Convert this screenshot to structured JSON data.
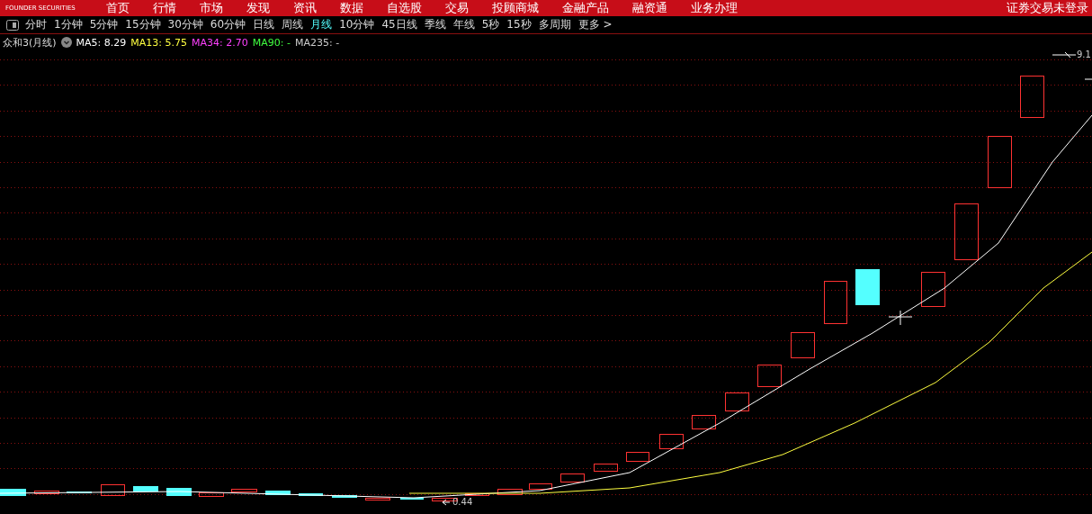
{
  "header": {
    "logo": "FOUNDER SECURITIES",
    "nav": [
      "首页",
      "行情",
      "市场",
      "发现",
      "资讯",
      "数据",
      "自选股",
      "交易",
      "投顾商城",
      "金融产品",
      "融资通",
      "业务办理"
    ],
    "login": "证券交易未登录"
  },
  "periods": [
    {
      "label": "分时",
      "selected": false
    },
    {
      "label": "1分钟",
      "selected": false
    },
    {
      "label": "5分钟",
      "selected": false
    },
    {
      "label": "15分钟",
      "selected": false
    },
    {
      "label": "30分钟",
      "selected": false
    },
    {
      "label": "60分钟",
      "selected": false
    },
    {
      "label": "日线",
      "selected": false
    },
    {
      "label": "周线",
      "selected": false
    },
    {
      "label": "月线",
      "selected": true
    },
    {
      "label": "10分钟",
      "selected": false
    },
    {
      "label": "45日线",
      "selected": false
    },
    {
      "label": "季线",
      "selected": false
    },
    {
      "label": "年线",
      "selected": false
    },
    {
      "label": "5秒",
      "selected": false
    },
    {
      "label": "15秒",
      "selected": false
    },
    {
      "label": "多周期",
      "selected": false
    },
    {
      "label": "更多 >",
      "selected": false
    }
  ],
  "legend": {
    "title": "众和3(月线)",
    "indicators": [
      {
        "text": "MA5: 8.29",
        "color": "#ffffff"
      },
      {
        "text": "MA13: 5.75",
        "color": "#ffff40"
      },
      {
        "text": "MA34: 2.70",
        "color": "#ff40ff"
      },
      {
        "text": "MA90: -",
        "color": "#40ff40"
      },
      {
        "text": "MA235: -",
        "color": "#cccccc"
      }
    ]
  },
  "chart": {
    "high_label": "9.1",
    "low_label": "0.44"
  }
}
